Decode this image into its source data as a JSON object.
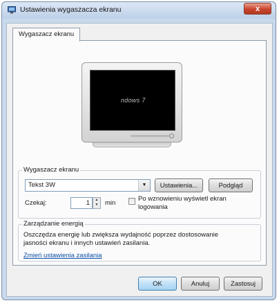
{
  "window": {
    "title": "Ustawienia wygaszacza ekranu",
    "close_glyph": "x"
  },
  "tabs": [
    {
      "label": "Wygaszacz ekranu"
    }
  ],
  "preview": {
    "screen_text": "ndows 7"
  },
  "screensaver": {
    "group_label": "Wygaszacz ekranu",
    "selected": "Tekst 3W",
    "settings_button": "Ustawienia...",
    "preview_button": "Podgląd",
    "wait_label": "Czekaj:",
    "wait_value": "1",
    "wait_unit": "min",
    "resume_label_line1": "Po wznowieniu wyświetl ekran",
    "resume_label_line2": "logowania",
    "resume_checked": false
  },
  "power": {
    "group_label": "Zarządzanie energią",
    "description_line1": "Oszczędza energię lub zwiększa wydajność poprzez dostosowanie",
    "description_line2": "jasności ekranu i innych ustawień zasilania.",
    "link": "Zmień ustawienia zasilania"
  },
  "buttons": {
    "ok": "OK",
    "cancel": "Anuluj",
    "apply": "Zastosuj"
  }
}
